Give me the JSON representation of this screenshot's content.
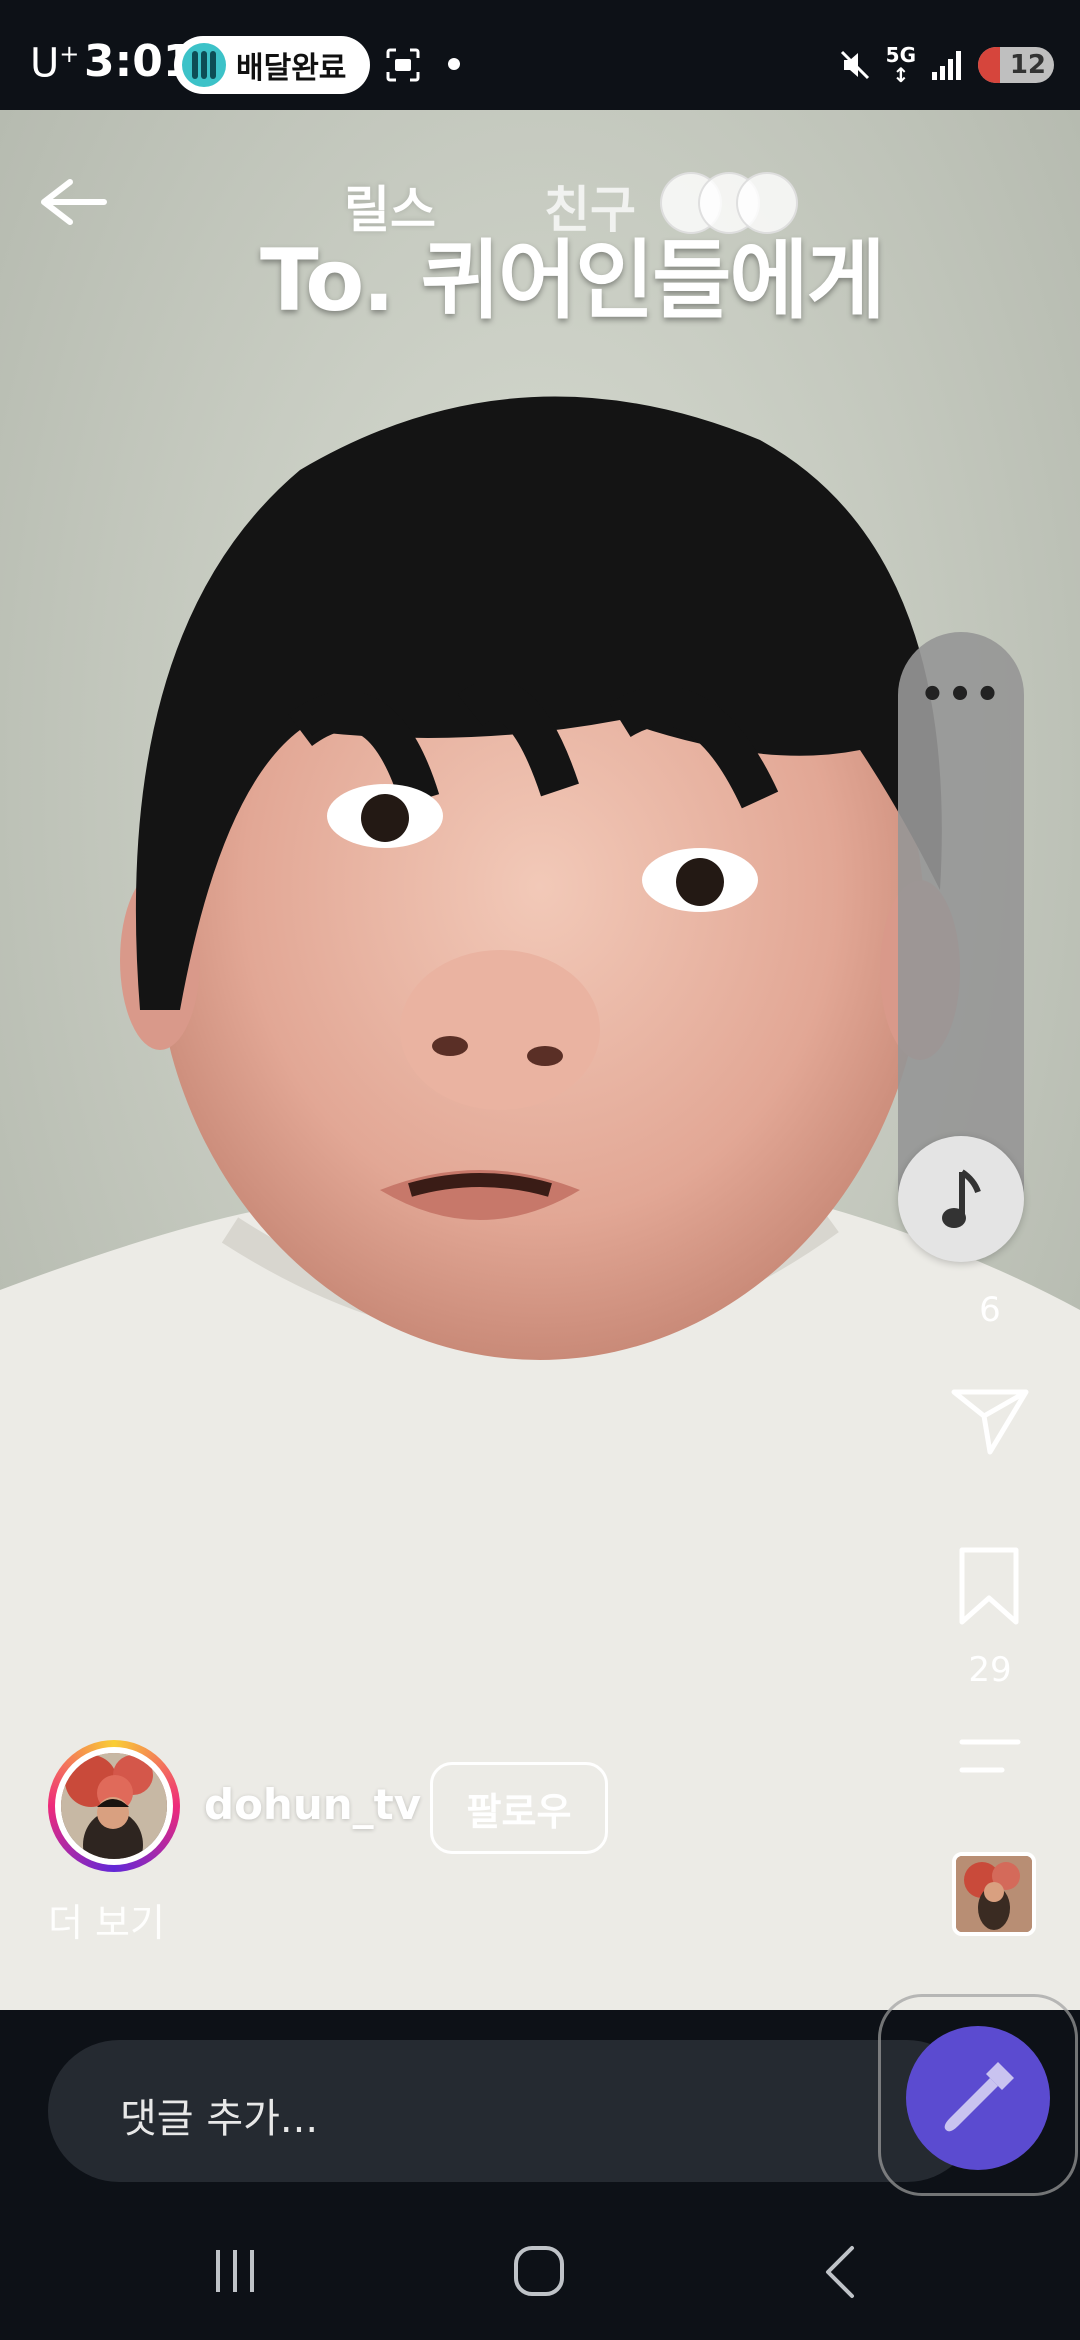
{
  "status_bar": {
    "carrier": "U",
    "carrier_sup": "+",
    "time": "3:01",
    "notification_pill": "배달완료",
    "network": "5G",
    "battery": "12"
  },
  "header": {
    "tab_reels": "릴스",
    "tab_friends": "친구"
  },
  "video": {
    "caption_title": "To. 퀴어인들에게"
  },
  "actions": {
    "more_menu": "•••",
    "comments_count": "6",
    "saves_count": "29"
  },
  "author": {
    "username": "dohun_tv",
    "follow_label": "팔로우",
    "more_label": "더 보기"
  },
  "comment_bar": {
    "placeholder": "댓글 추가..."
  },
  "colors": {
    "background": "#0d1117",
    "follow_border": "#ffffff",
    "floating_button": "#5b4bd0",
    "pill_accent": "#3cc2c8"
  }
}
